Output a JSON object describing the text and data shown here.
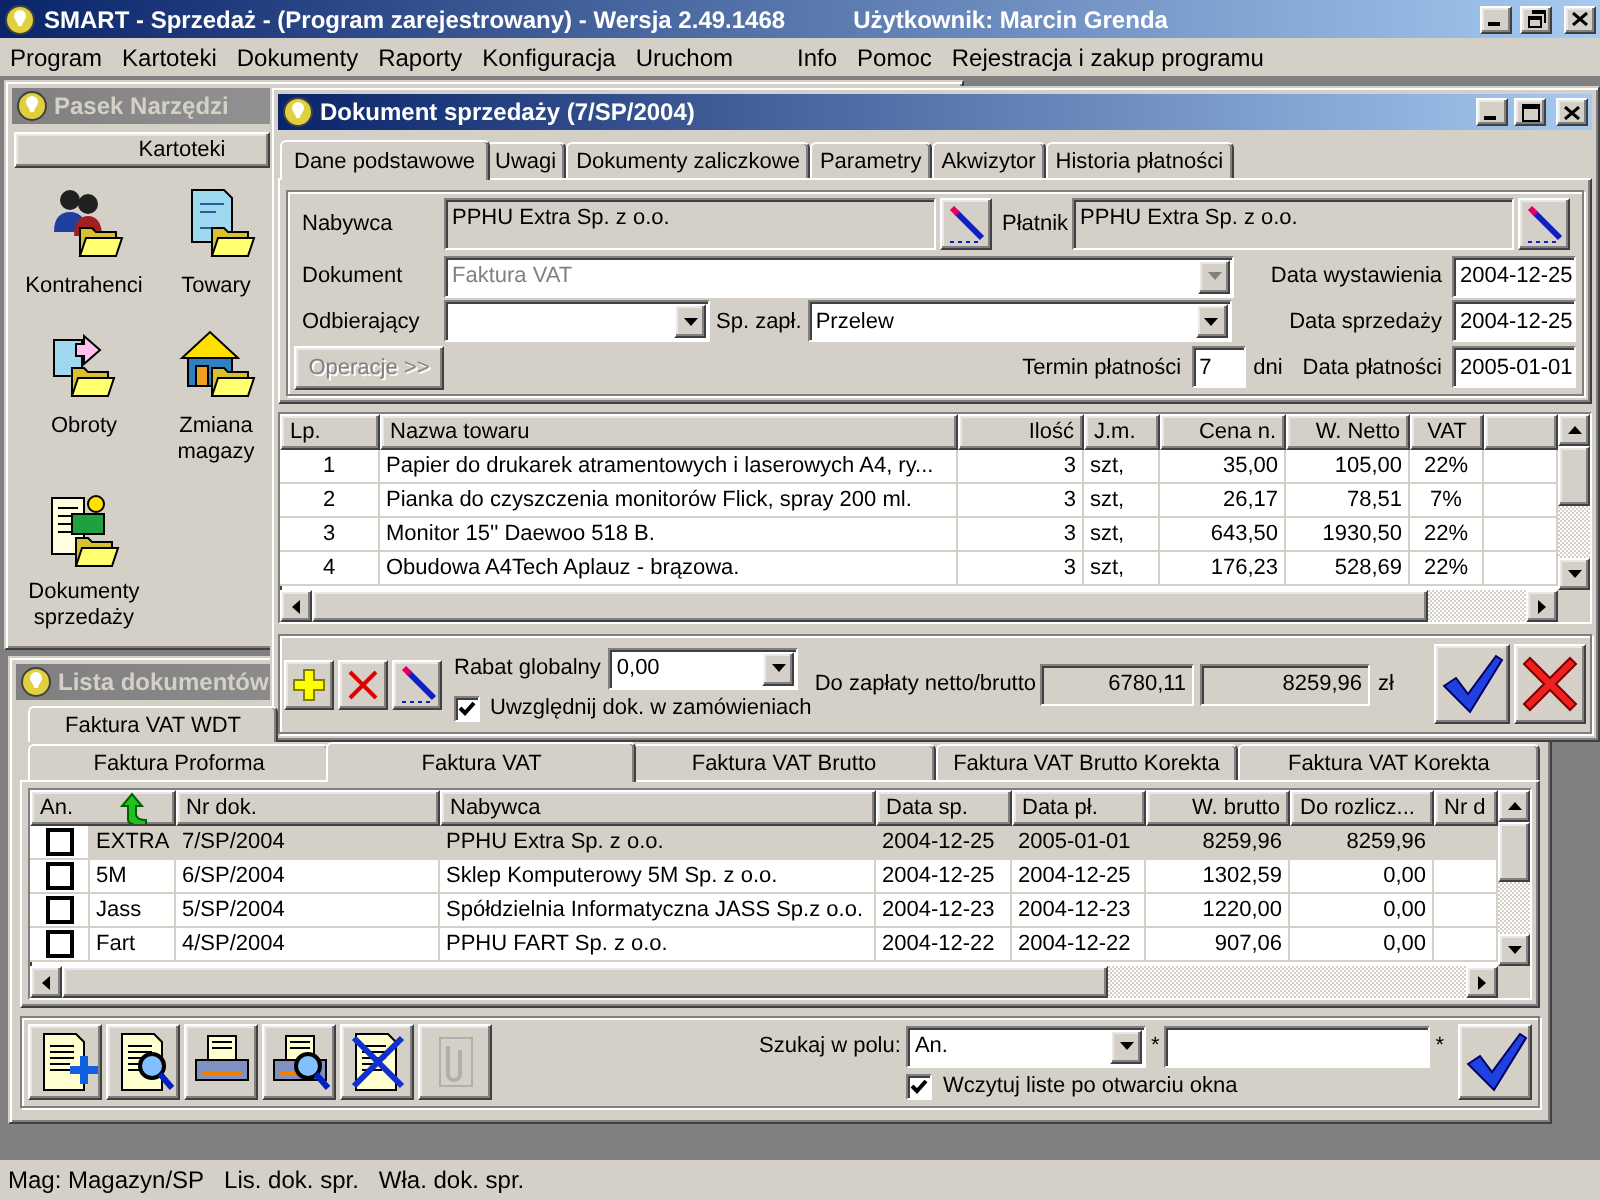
{
  "app_window": {
    "title": "SMART - Sprzedaż - (Program zarejestrowany) - Wersja 2.49.1468",
    "user": "Użytkownik: Marcin Grenda"
  },
  "menu_left": [
    "Program",
    "Kartoteki",
    "Dokumenty",
    "Raporty",
    "Konfiguracja",
    "Uruchom"
  ],
  "menu_right": [
    "Info",
    "Pomoc",
    "Rejestracja i zakup programu"
  ],
  "toolbar_window": {
    "title": "Pasek Narzędzi",
    "section": "Kartoteki",
    "items": [
      {
        "label": "Kontrahenci",
        "kind": "contractors"
      },
      {
        "label": "Towary",
        "kind": "goods"
      },
      {
        "label": "Obroty",
        "kind": "turnover"
      },
      {
        "label": "Zmiana magazy",
        "kind": "warehouse"
      },
      {
        "label": "Dokumenty sprzedaży",
        "kind": "sales"
      }
    ]
  },
  "sales_document_window": {
    "title": "Dokument sprzedaży (7/SP/2004)",
    "tabs": [
      {
        "label": "Dane podstawowe",
        "selected": true
      },
      {
        "label": "Uwagi",
        "selected": false
      },
      {
        "label": "Dokumenty zaliczkowe",
        "selected": false
      },
      {
        "label": "Parametry",
        "selected": false
      },
      {
        "label": "Akwizytor",
        "selected": false
      },
      {
        "label": "Historia płatności",
        "selected": false
      }
    ],
    "buyer": {
      "label": "Nabywca",
      "value": "PPHU Extra Sp. z o.o."
    },
    "payer": {
      "label": "Płatnik",
      "value": "PPHU Extra Sp. z o.o."
    },
    "document": {
      "label": "Dokument",
      "value": "Faktura VAT",
      "disabled": true
    },
    "receiver": {
      "label": "Odbierający"
    },
    "payment_method": {
      "label": "Sp. zapł.",
      "value": "Przelew"
    },
    "operations_button": {
      "label": "Operacje >>",
      "disabled": true
    },
    "issue_date": {
      "label": "Data wystawienia",
      "value": "2004-12-25"
    },
    "sale_date": {
      "label": "Data sprzedaży",
      "value": "2004-12-25"
    },
    "payment_term": {
      "label": "Termin płatności",
      "value": "7",
      "unit": "dni"
    },
    "payment_date": {
      "label": "Data płatności",
      "value": "2005-01-01"
    },
    "items_table": {
      "columns": [
        "Lp.",
        "Nazwa towaru",
        "Ilość",
        "J.m.",
        "Cena n.",
        "W. Netto",
        "VAT"
      ],
      "rows": [
        [
          "1",
          "Papier do drukarek atramentowych i laserowych A4, ry...",
          "3",
          "szt,",
          "35,00",
          "105,00",
          "22%"
        ],
        [
          "2",
          "Pianka do czyszczenia monitorów Flick, spray 200 ml.",
          "3",
          "szt,",
          "26,17",
          "78,51",
          "7%"
        ],
        [
          "3",
          "Monitor 15'' Daewoo 518 B.",
          "3",
          "szt,",
          "643,50",
          "1930,50",
          "22%"
        ],
        [
          "4",
          "Obudowa A4Tech Aplauz - brązowa.",
          "3",
          "szt,",
          "176,23",
          "528,69",
          "22%"
        ]
      ]
    },
    "discount": {
      "label": "Rabat globalny",
      "value": "0,00"
    },
    "include_orders": {
      "label": "Uwzględnij dok. w zamówieniach",
      "checked": true
    },
    "total": {
      "label": "Do zapłaty netto/brutto",
      "net": "6780,11",
      "gross": "8259,96",
      "currency": "zł"
    }
  },
  "document_list_window": {
    "title": "Lista dokumentów",
    "back_tabs": [
      {
        "label": "Faktura VAT WDT",
        "selected": false
      }
    ],
    "tabs": [
      {
        "label": "Faktura Proforma",
        "selected": false
      },
      {
        "label": "Faktura VAT",
        "selected": true
      },
      {
        "label": "Faktura VAT Brutto",
        "selected": false
      },
      {
        "label": "Faktura VAT Brutto Korekta",
        "selected": false
      },
      {
        "label": "Faktura VAT Korekta",
        "selected": false
      }
    ],
    "table": {
      "columns": [
        "An.",
        "Nr dok.",
        "Nabywca",
        "Data sp.",
        "Data pł.",
        "W. brutto",
        "Do rozlicz...",
        "Nr d"
      ],
      "rows": [
        {
          "selected": true,
          "checked": false,
          "code": "EXTRA",
          "number": "7/SP/2004",
          "buyer": "PPHU Extra Sp. z o.o.",
          "sale_date": "2004-12-25",
          "payment_date": "2005-01-01",
          "gross": "8259,96",
          "to_settle": "8259,96"
        },
        {
          "selected": false,
          "checked": false,
          "code": "5M",
          "number": "6/SP/2004",
          "buyer": "Sklep Komputerowy 5M Sp. z o.o.",
          "sale_date": "2004-12-25",
          "payment_date": "2004-12-25",
          "gross": "1302,59",
          "to_settle": "0,00"
        },
        {
          "selected": false,
          "checked": false,
          "code": "Jass",
          "number": "5/SP/2004",
          "buyer": "Spółdzielnia Informatyczna JASS Sp.z o.o.",
          "sale_date": "2004-12-23",
          "payment_date": "2004-12-23",
          "gross": "1220,00",
          "to_settle": "0,00"
        },
        {
          "selected": false,
          "checked": false,
          "code": "Fart",
          "number": "4/SP/2004",
          "buyer": "PPHU FART Sp. z o.o.",
          "sale_date": "2004-12-22",
          "payment_date": "2004-12-22",
          "gross": "907,06",
          "to_settle": "0,00"
        }
      ]
    },
    "toolbar": [
      {
        "kind": "new",
        "disabled": false
      },
      {
        "kind": "preview",
        "disabled": false
      },
      {
        "kind": "print",
        "disabled": false
      },
      {
        "kind": "print_preview",
        "disabled": false
      },
      {
        "kind": "delete",
        "disabled": false
      },
      {
        "kind": "attach",
        "disabled": true
      }
    ],
    "search": {
      "label": "Szukaj w polu:",
      "field": "An.",
      "wildcard_before": "*",
      "wildcard_after": "*"
    },
    "load_on_open": {
      "label": "Wczytuj liste po otwarciu okna",
      "checked": true
    }
  },
  "status_bar": [
    "Mag: Magazyn/SP",
    "Lis. dok. spr.",
    "Wła. dok. spr."
  ]
}
